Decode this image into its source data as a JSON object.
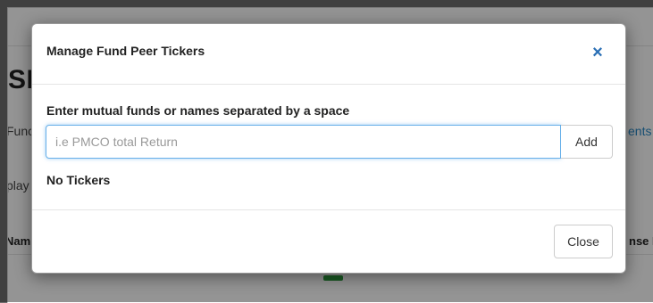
{
  "background": {
    "heading": "SE",
    "fund_label": "Func",
    "display_label": "play",
    "name_header": "Nam",
    "events_link": "ents",
    "expense_header": "nse F"
  },
  "modal": {
    "title": "Manage Fund Peer Tickers",
    "close_icon": "×",
    "input_label": "Enter mutual funds or names separated by a space",
    "input_placeholder": "i.e PMCO total Return",
    "input_value": "",
    "add_button": "Add",
    "empty_state": "No Tickers",
    "close_button": "Close"
  },
  "colors": {
    "accent": "#2a6fb5",
    "input_focus": "#66afe9",
    "link": "#2a8ac8",
    "status_green": "#2e9e3f"
  }
}
